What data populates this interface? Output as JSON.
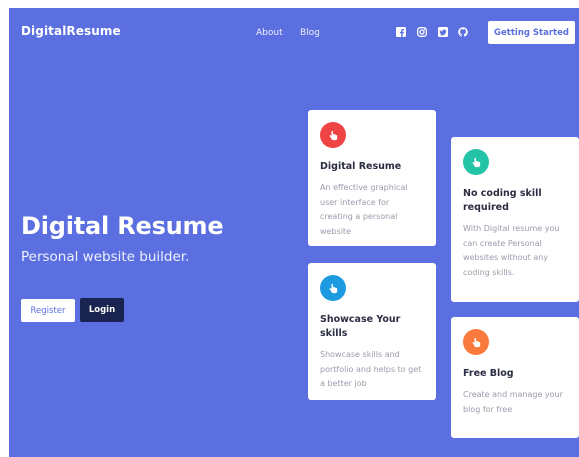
{
  "header": {
    "brand": "DigitalResume",
    "nav": [
      {
        "label": "About"
      },
      {
        "label": "Blog"
      }
    ],
    "social": [
      {
        "icon": "facebook-icon"
      },
      {
        "icon": "instagram-icon"
      },
      {
        "icon": "twitter-icon"
      },
      {
        "icon": "github-icon"
      }
    ],
    "cta_label": "Getting Started"
  },
  "hero": {
    "title": "Digital Resume",
    "subtitle": "Personal website builder.",
    "register_label": "Register",
    "login_label": "Login"
  },
  "cards": [
    {
      "icon": "hand-pointer-icon",
      "icon_color": "#ef4444",
      "title": "Digital Resume",
      "text": "An effective graphical user interface for creating a personal website"
    },
    {
      "icon": "hand-pointer-icon",
      "icon_color": "#1e9be0",
      "title": "Showcase Your skills",
      "text": "Showcase skills and portfolio and helps to get a better job"
    },
    {
      "icon": "hand-pointer-icon",
      "icon_color": "#22c3a6",
      "title": "No coding skill required",
      "text": "With Digital resume you can create Personal websites without any coding skills."
    },
    {
      "icon": "hand-pointer-icon",
      "icon_color": "#f97a3a",
      "title": "Free Blog",
      "text": "Create and manage your blog for free"
    }
  ],
  "colors": {
    "background": "#5b6fe0",
    "login_button": "#1a2450",
    "card_text": "#9a9cab"
  }
}
